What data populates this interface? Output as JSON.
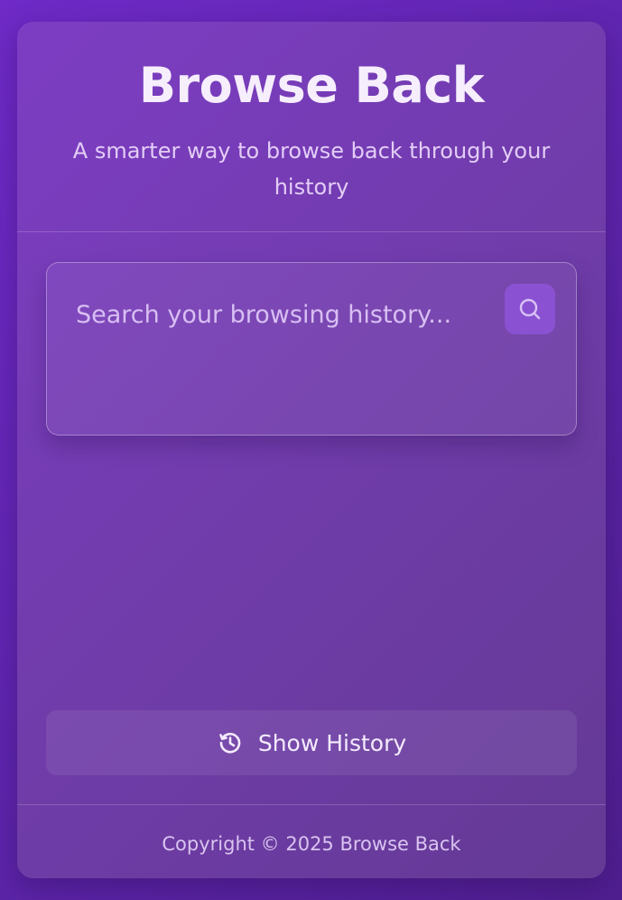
{
  "app": {
    "title": "Browse Back",
    "subtitle": "A smarter way to browse back through your history"
  },
  "search": {
    "placeholder": "Search your browsing history...",
    "value": "",
    "button_icon": "search-icon"
  },
  "actions": {
    "show_history_label": "Show History",
    "show_history_icon": "history-icon"
  },
  "footer": {
    "copyright": "Copyright © 2025 Browse Back"
  },
  "colors": {
    "background": "#6a28bb",
    "card": "#7638b5",
    "search_button": "#8a52d2",
    "title_text": "#f6eefd"
  }
}
